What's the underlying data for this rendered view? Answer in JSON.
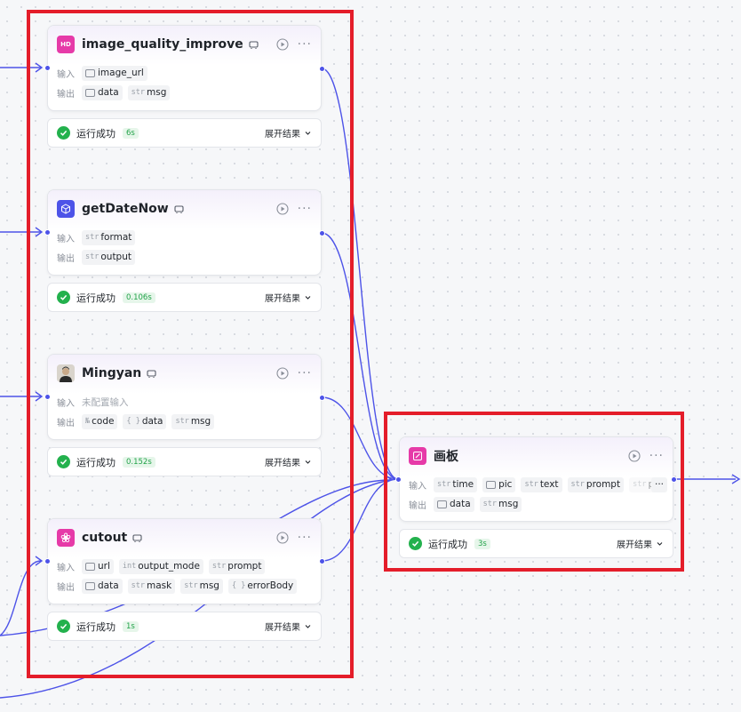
{
  "labels": {
    "input": "输入",
    "output": "输出",
    "expand": "展开结果",
    "run_success": "运行成功"
  },
  "colors": {
    "edge": "#4d53e8",
    "highlight": "#e41d2a",
    "success": "#23b14d"
  },
  "nodes": [
    {
      "title": "image_quality_improve",
      "icon": "hd-icon",
      "icon_text": "HD",
      "icon_color": "#e63aa8",
      "inputs": [
        {
          "type": "image",
          "name": "image_url"
        }
      ],
      "outputs": [
        {
          "type": "image",
          "name": "data"
        },
        {
          "type": "str",
          "name": "msg"
        }
      ],
      "status": "运行成功",
      "time": "6s"
    },
    {
      "title": "getDateNow",
      "icon": "cube-icon",
      "icon_color": "#4d53e8",
      "inputs": [
        {
          "type": "str",
          "name": "format"
        }
      ],
      "outputs": [
        {
          "type": "str",
          "name": "output"
        }
      ],
      "status": "运行成功",
      "time": "0.106s"
    },
    {
      "title": "Mingyan",
      "icon": "avatar-icon",
      "icon_color": "#3a3a3a",
      "input_placeholder": "未配置输入",
      "outputs": [
        {
          "type": "№",
          "name": "code"
        },
        {
          "type": "{ }",
          "name": "data"
        },
        {
          "type": "str",
          "name": "msg"
        }
      ],
      "status": "运行成功",
      "time": "0.152s"
    },
    {
      "title": "cutout",
      "icon": "flower-icon",
      "icon_color": "#e63aa8",
      "inputs": [
        {
          "type": "image",
          "name": "url"
        },
        {
          "type": "int",
          "name": "output_mode"
        },
        {
          "type": "str",
          "name": "prompt"
        }
      ],
      "outputs": [
        {
          "type": "image",
          "name": "data"
        },
        {
          "type": "str",
          "name": "mask"
        },
        {
          "type": "str",
          "name": "msg"
        },
        {
          "type": "{ }",
          "name": "errorBody"
        }
      ],
      "status": "运行成功",
      "time": "1s"
    },
    {
      "title": "画板",
      "icon": "canvas-icon",
      "icon_color": "#e63aa8",
      "inputs": [
        {
          "type": "str",
          "name": "time"
        },
        {
          "type": "image",
          "name": "pic"
        },
        {
          "type": "str",
          "name": "text"
        },
        {
          "type": "str",
          "name": "prompt"
        },
        {
          "type": "str",
          "name": "p"
        }
      ],
      "outputs": [
        {
          "type": "image",
          "name": "data"
        },
        {
          "type": "str",
          "name": "msg"
        }
      ],
      "more_label": "···",
      "status": "运行成功",
      "time": "3s"
    }
  ]
}
